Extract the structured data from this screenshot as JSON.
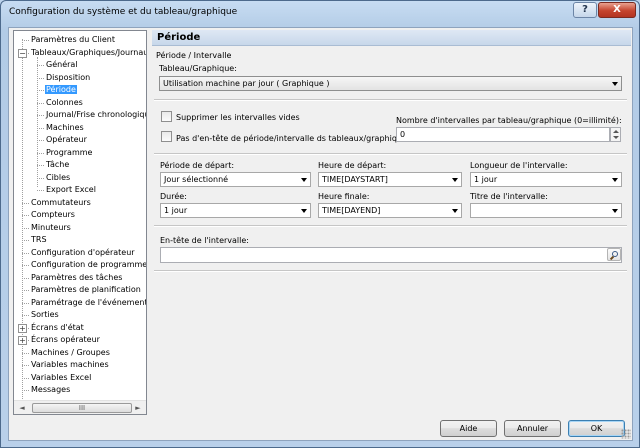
{
  "window": {
    "title": "Configuration du système et du tableau/graphique",
    "help_label": "?",
    "close_label": "X"
  },
  "tree": {
    "items": [
      {
        "label": "Paramètres du Client"
      },
      {
        "label": "Tableaux/Graphiques/Journaux",
        "expanded": true
      },
      {
        "label": "Général"
      },
      {
        "label": "Disposition"
      },
      {
        "label": "Période",
        "selected": true
      },
      {
        "label": "Colonnes"
      },
      {
        "label": "Journal/Frise chronologique"
      },
      {
        "label": "Machines"
      },
      {
        "label": "Opérateur"
      },
      {
        "label": "Programme"
      },
      {
        "label": "Tâche"
      },
      {
        "label": "Cibles"
      },
      {
        "label": "Export Excel"
      },
      {
        "label": "Commutateurs"
      },
      {
        "label": "Compteurs"
      },
      {
        "label": "Minuteurs"
      },
      {
        "label": "TRS"
      },
      {
        "label": "Configuration d'opérateur"
      },
      {
        "label": "Configuration de programme"
      },
      {
        "label": "Paramètres des tâches"
      },
      {
        "label": "Paramètres de planification"
      },
      {
        "label": "Paramétrage de l'événement"
      },
      {
        "label": "Sorties"
      },
      {
        "label": "Écrans d'état",
        "collapsed": true
      },
      {
        "label": "Écrans opérateur",
        "collapsed": true
      },
      {
        "label": "Machines / Groupes"
      },
      {
        "label": "Variables machines"
      },
      {
        "label": "Variables Excel"
      },
      {
        "label": "Messages"
      }
    ],
    "expand_minus": "−",
    "expand_plus": "+",
    "scroll_left": "◄",
    "scroll_right": "►",
    "scroll_thumb": "III"
  },
  "panel": {
    "header": "Période",
    "group_label": "Période / Intervalle",
    "table_graph_label": "Tableau/Graphique:",
    "table_graph_value": "Utilisation machine par jour  ( Graphique )",
    "suppress_empty_label": "Supprimer les intervalles vides",
    "suppress_empty_checked": false,
    "no_header_label": "Pas d'en-tête de période/intervalle ds tableaux/graphique",
    "no_header_checked": false,
    "intervals_count_label": "Nombre d'intervalles par tableau/graphique (0=illimité):",
    "intervals_count_value": "0",
    "start_period_label": "Période de départ:",
    "start_period_value": "Jour sélectionné",
    "start_time_label": "Heure de départ:",
    "start_time_value": "TIME[DAYSTART]",
    "interval_length_label": "Longueur de l'intervalle:",
    "interval_length_value": "1 jour",
    "duration_label": "Durée:",
    "duration_value": "1 jour",
    "end_time_label": "Heure finale:",
    "end_time_value": "TIME[DAYEND]",
    "interval_title_label": "Titre de l'intervalle:",
    "interval_title_value": "",
    "interval_header_label": "En-tête de l'intervalle:",
    "interval_header_value": ""
  },
  "buttons": {
    "help": "Aide",
    "cancel": "Annuler",
    "ok": "OK"
  }
}
